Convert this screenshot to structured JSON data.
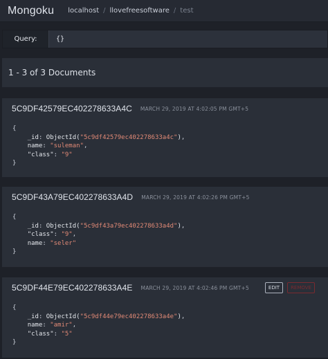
{
  "brand": "Mongoku",
  "breadcrumb": [
    "localhost",
    "llovefreesoftware",
    "test"
  ],
  "breadcrumb_sep": "/",
  "query": {
    "label": "Query:",
    "value": "{}"
  },
  "results_summary": "1 - 3 of 3 Documents",
  "actions": {
    "edit": "EDIT",
    "remove": "REMOVE"
  },
  "documents": [
    {
      "id": "5C9DF42579EC402278633A4C",
      "date": "MARCH 29, 2019 AT 4:02:05 PM GMT+5",
      "fields": [
        {
          "key": "_id",
          "wrap": "ObjectId(",
          "value": "\"5c9df42579ec402278633a4c\"",
          "wrap_end": ")",
          "comma": ","
        },
        {
          "key": "name",
          "value": "\"suleman\"",
          "comma": ","
        },
        {
          "key": "\"class\"",
          "value": "\"9\"",
          "comma": ""
        }
      ]
    },
    {
      "id": "5C9DF43A79EC402278633A4D",
      "date": "MARCH 29, 2019 AT 4:02:26 PM GMT+5",
      "fields": [
        {
          "key": "_id",
          "wrap": "ObjectId(",
          "value": "\"5c9df43a79ec402278633a4d\"",
          "wrap_end": ")",
          "comma": ","
        },
        {
          "key": "\"class\"",
          "value": "\"9\"",
          "comma": ","
        },
        {
          "key": "name",
          "value": "\"seler\"",
          "comma": ""
        }
      ]
    },
    {
      "id": "5C9DF44E79EC402278633A4E",
      "date": "MARCH 29, 2019 AT 4:02:46 PM GMT+5",
      "fields": [
        {
          "key": "_id",
          "wrap": "ObjectId(",
          "value": "\"5c9df44e79ec402278633a4e\"",
          "wrap_end": ")",
          "comma": ","
        },
        {
          "key": "name",
          "value": "\"amir\"",
          "comma": ","
        },
        {
          "key": "\"class\"",
          "value": "\"5\"",
          "comma": ""
        }
      ]
    }
  ],
  "colors": {
    "background": "#1e2128",
    "panel": "#2a2f38",
    "string": "#e28a76",
    "remove": "#7a2a30"
  }
}
